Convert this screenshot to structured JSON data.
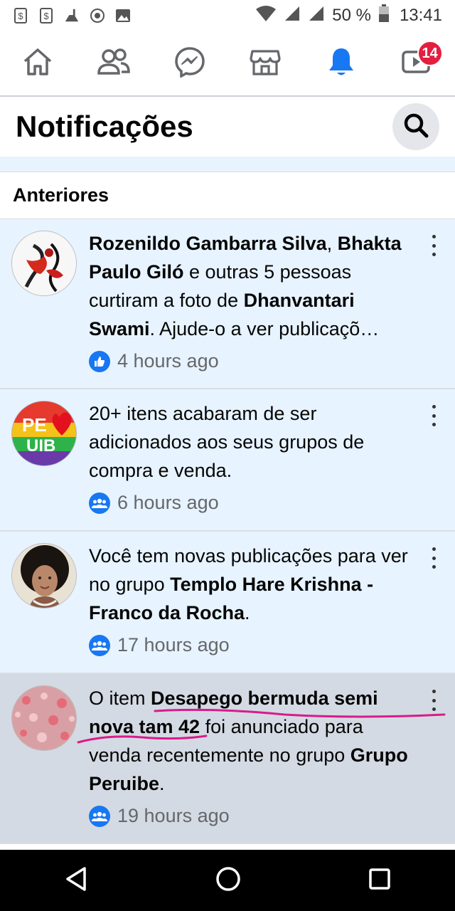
{
  "status_bar": {
    "battery": "50 %",
    "time": "13:41"
  },
  "nav": {
    "items": [
      {
        "name": "home"
      },
      {
        "name": "friends"
      },
      {
        "name": "messenger"
      },
      {
        "name": "marketplace"
      },
      {
        "name": "notifications",
        "active_color": "#1877f2"
      },
      {
        "name": "watch",
        "badge": "14"
      }
    ]
  },
  "header": {
    "title": "Notificações"
  },
  "section": {
    "title": "Anteriores"
  },
  "notifications": [
    {
      "text_html": "<b>Rozenildo Gambarra Silva</b>, <b>Bhakta Paulo Giló</b> e outras 5 pessoas curtiram a foto de <b>Dhanvantari Swami</b>. Ajude-o a ver publicaçõ…",
      "time": "4 hours ago",
      "type_icon": "like-icon"
    },
    {
      "text_html": "20+ itens acabaram de ser adicionados aos seus grupos de compra e venda.",
      "time": "6 hours ago",
      "type_icon": "group-icon"
    },
    {
      "text_html": "Você tem novas publicações para ver no grupo <b>Templo Hare Krishna - Franco da Rocha</b>.",
      "time": "17 hours ago",
      "type_icon": "group-icon"
    },
    {
      "text_html": "O item <b>Desapego bermuda semi nova tam 42</b> foi anunciado para venda recentemente no grupo <b>Grupo Peruibe</b>.",
      "time": "19 hours ago",
      "type_icon": "group-icon"
    }
  ],
  "colors": {
    "accent": "#1877f2",
    "unread_bg": "#e7f3ff",
    "badge": "#e41e3f",
    "annotation": "#d81b8c"
  }
}
